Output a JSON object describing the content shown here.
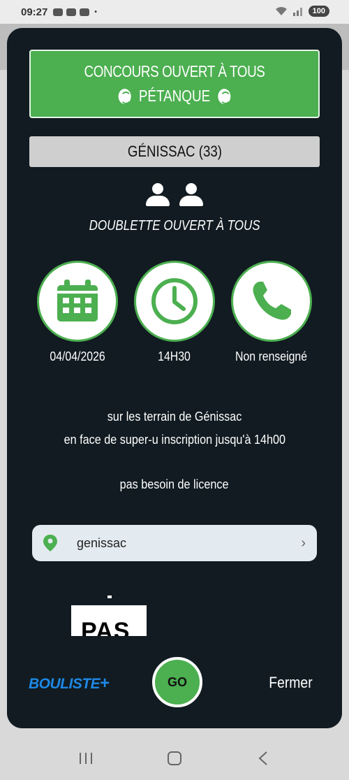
{
  "status_bar": {
    "time": "09:27",
    "battery": "100"
  },
  "banner": {
    "line1": "CONCOURS OUVERT À TOUS",
    "line2": "PÉTANQUE"
  },
  "location": "GÉNISSAC (33)",
  "format": "DOUBLETTE OUVERT À TOUS",
  "info": {
    "date": "04/04/2026",
    "time": "14H30",
    "phone": "Non renseigné"
  },
  "description": {
    "line1": "sur les terrain de Génissac",
    "line2": "en face de super-u inscription jusqu'à 14h00",
    "line3": "pas besoin de licence"
  },
  "map": {
    "place": "genissac"
  },
  "poster_text": "PAS",
  "footer": {
    "logo": "BOULISTE",
    "logo_plus": "+",
    "go_label": "GO",
    "close_label": "Fermer"
  },
  "colors": {
    "accent": "#4caf50",
    "modal_bg": "#111b21",
    "logo_blue": "#1e88e5"
  },
  "icons": [
    "calendar-icon",
    "clock-icon",
    "phone-icon",
    "map-pin-icon",
    "chevron-right-icon",
    "person-icon",
    "petanque-ball-icon"
  ]
}
